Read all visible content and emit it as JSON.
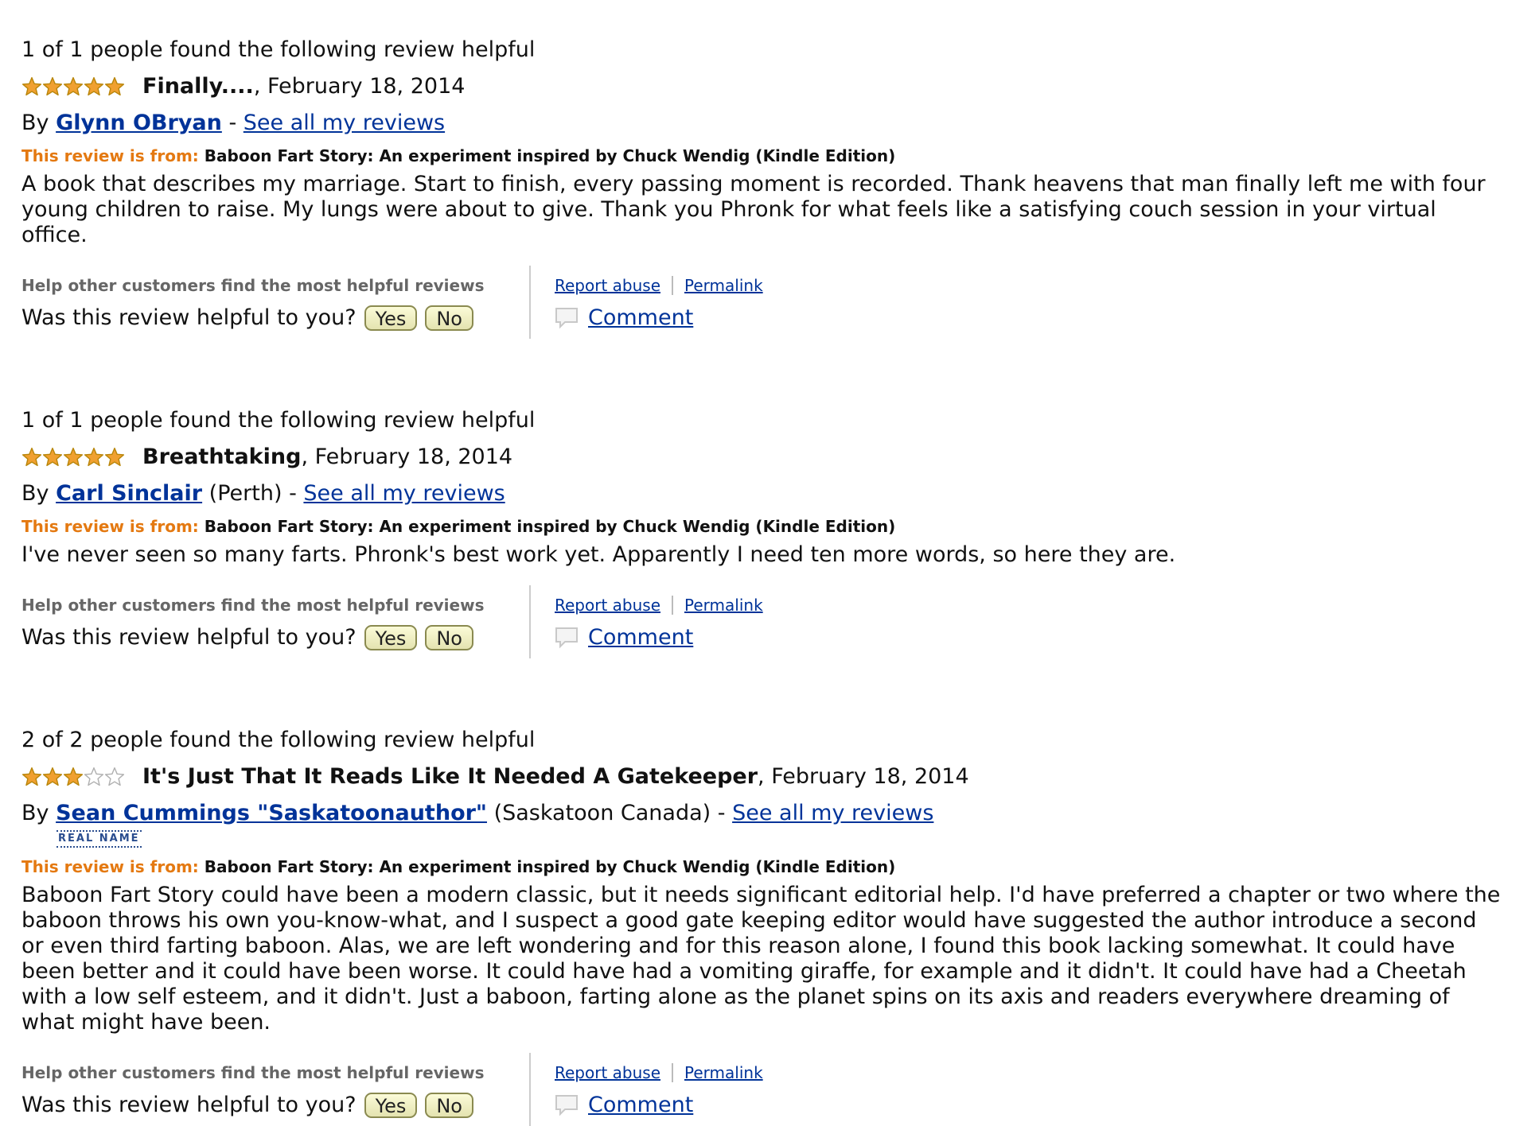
{
  "ui": {
    "by": "By",
    "dash": "-",
    "see_all": "See all my reviews",
    "from_label": "This review is from:",
    "help_label": "Help other customers find the most helpful reviews",
    "was_helpful": "Was this review helpful to you?",
    "yes": "Yes",
    "no": "No",
    "report_abuse": "Report abuse",
    "permalink": "Permalink",
    "comment": "Comment",
    "real_name": "REAL NAME"
  },
  "colors": {
    "link": "#003399",
    "from_label": "#e47911",
    "star_filled": "#f0a030",
    "star_empty": "#ffffff",
    "star_outline": "#b8860b"
  },
  "icons": {
    "star": "star-icon",
    "comment": "comment-bubble-icon"
  },
  "reviews": [
    {
      "helpful_count": "1 of 1 people found the following review helpful",
      "rating": 5,
      "rating_max": 5,
      "title": "Finally....",
      "date": ", February 18, 2014",
      "author": "Glynn OBryan",
      "location": "",
      "real_name_badge": false,
      "product": "Baboon Fart Story: An experiment inspired by Chuck Wendig (Kindle Edition)",
      "body": "A book that describes my marriage. Start to finish, every passing moment is recorded. Thank heavens that man finally left me with four young children to raise. My lungs were about to give. Thank you Phronk for what feels like a satisfying couch session in your virtual office."
    },
    {
      "helpful_count": "1 of 1 people found the following review helpful",
      "rating": 5,
      "rating_max": 5,
      "title": "Breathtaking",
      "date": ", February 18, 2014",
      "author": "Carl Sinclair",
      "location": " (Perth)",
      "real_name_badge": false,
      "product": "Baboon Fart Story: An experiment inspired by Chuck Wendig (Kindle Edition)",
      "body": "I've never seen so many farts. Phronk's best work yet. Apparently I need ten more words, so here they are."
    },
    {
      "helpful_count": "2 of 2 people found the following review helpful",
      "rating": 3,
      "rating_max": 5,
      "title": "It's Just That It Reads Like It Needed A Gatekeeper",
      "date": ", February 18, 2014",
      "author": "Sean Cummings \"Saskatoonauthor\"",
      "location": " (Saskatoon Canada)",
      "real_name_badge": true,
      "product": "Baboon Fart Story: An experiment inspired by Chuck Wendig (Kindle Edition)",
      "body": "Baboon Fart Story could have been a modern classic, but it needs significant editorial help. I'd have preferred a chapter or two where the baboon throws his own you-know-what, and I suspect a good gate keeping editor would have suggested the author introduce a second or even third farting baboon. Alas, we are left wondering and for this reason alone, I found this book lacking somewhat. It could have been better and it could have been worse. It could have had a vomiting giraffe, for example and it didn't. It could have had a Cheetah with a low self esteem, and it didn't. Just a baboon, farting alone as the planet spins on its axis and readers everywhere dreaming of what might have been."
    }
  ]
}
